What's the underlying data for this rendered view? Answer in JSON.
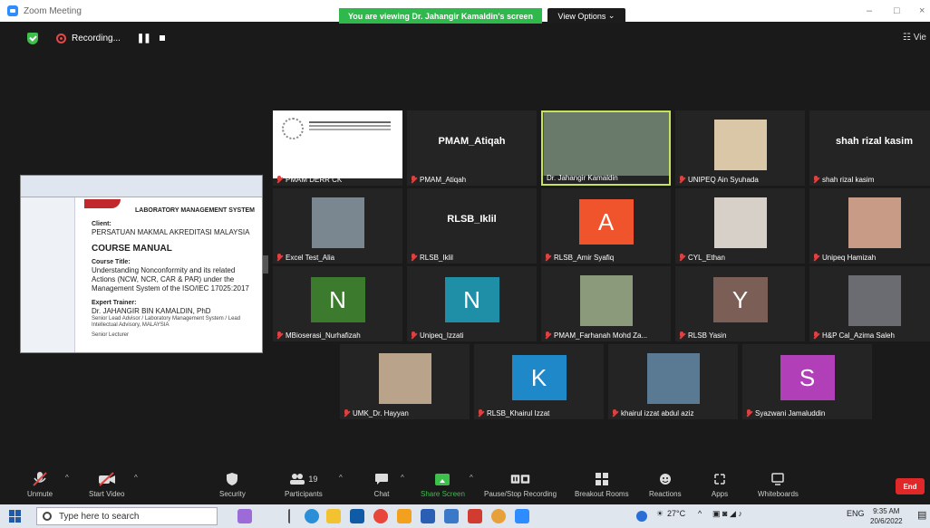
{
  "window": {
    "title": "Zoom Meeting",
    "viewing_banner": "You are viewing Dr. Jahangir Kamaldin's screen",
    "view_options": "View Options",
    "controls": [
      "–",
      "□",
      "×"
    ]
  },
  "topbar": {
    "recording_label": "Recording...",
    "view_label": "Vie"
  },
  "shared_screen": {
    "header": "LABORATORY MANAGEMENT SYSTEM",
    "client_label": "Client:",
    "client_name": "PERSATUAN MAKMAL AKREDITASI MALAYSIA",
    "course_manual": "COURSE MANUAL",
    "course_title_label": "Course Title:",
    "course_title": "Understanding Nonconformity and its related Actions (NCW, NCR, CAR & PAR) under the Management System of the ISO/IEC 17025:2017",
    "trainer_label": "Expert Trainer:",
    "trainer_name": "Dr. JAHANGIR BIN KAMALDIN, PhD",
    "trainer_roles": "Senior Lead Advisor / Laboratory Management System / Lead Intellectual Advisory, MALAYSIA",
    "footer_small": "Senior Lecturer"
  },
  "participants": [
    {
      "display": "logo",
      "name": "PMAM DERR CK"
    },
    {
      "display": "text",
      "big": "PMAM_Atiqah",
      "name": "PMAM_Atiqah"
    },
    {
      "display": "photo",
      "name": "Dr. Jahangir Kamaldin",
      "active": true
    },
    {
      "display": "photo",
      "name": "UNIPEQ Ain Syuhada"
    },
    {
      "display": "text",
      "big": "shah rizal kasim",
      "name": "shah rizal kasim"
    },
    {
      "display": "photo",
      "name": "Excel Test_Alia"
    },
    {
      "display": "text",
      "big": "RLSB_Iklil",
      "name": "RLSB_Iklil"
    },
    {
      "display": "letter",
      "letter": "A",
      "color": "#f0542c",
      "name": "RLSB_Amir Syafiq"
    },
    {
      "display": "photo",
      "name": "CYL_Ethan"
    },
    {
      "display": "photo",
      "name": "Unipeq Hamizah"
    },
    {
      "display": "letter",
      "letter": "N",
      "color": "#3c7a2e",
      "name": "MBioserasi_Nurhafizah"
    },
    {
      "display": "letter",
      "letter": "N",
      "color": "#1e8fa6",
      "name": "Unipeq_Izzati"
    },
    {
      "display": "photo",
      "name": "PMAM_Farhanah Mohd Za..."
    },
    {
      "display": "letter",
      "letter": "Y",
      "color": "#7b5e55",
      "name": "RLSB Yasin"
    },
    {
      "display": "photo",
      "name": "H&P Cal_Azima Saleh"
    },
    {
      "display": "photo",
      "name": "UMK_Dr. Hayyan"
    },
    {
      "display": "letter",
      "letter": "K",
      "color": "#1e88c8",
      "name": "RLSB_Khairul Izzat"
    },
    {
      "display": "photo",
      "name": "khairul izzat abdul aziz"
    },
    {
      "display": "letter",
      "letter": "S",
      "color": "#b03fb8",
      "name": "Syazwani Jamaluddin"
    }
  ],
  "toolbar": {
    "unmute": "Unmute",
    "start_video": "Start Video",
    "security": "Security",
    "participants": "Participants",
    "participants_count": "19",
    "chat": "Chat",
    "share_screen": "Share Screen",
    "pause_recording": "Pause/Stop Recording",
    "breakout_rooms": "Breakout Rooms",
    "reactions": "Reactions",
    "apps": "Apps",
    "whiteboards": "Whiteboards",
    "end": "End"
  },
  "taskbar": {
    "search_placeholder": "Type here to search",
    "temperature": "27°C",
    "language": "ENG",
    "time": "9:35 AM",
    "date": "20/6/2022"
  }
}
